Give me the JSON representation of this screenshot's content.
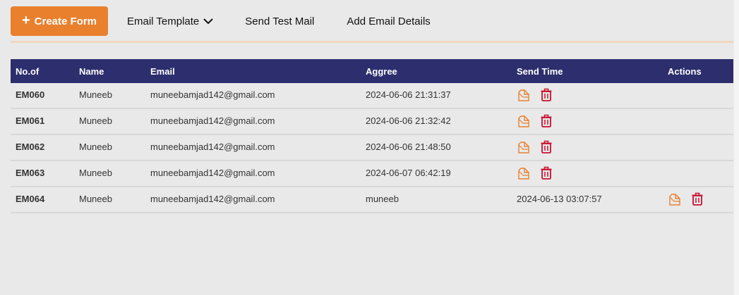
{
  "toolbar": {
    "create_label": "Create Form",
    "email_template_label": "Email Template",
    "send_test_label": "Send Test Mail",
    "add_details_label": "Add Email Details"
  },
  "table": {
    "headers": [
      "No.of",
      "Name",
      "Email",
      "Aggree",
      "Send Time",
      "Actions"
    ],
    "rows": [
      {
        "no": "EM060",
        "name": "Muneeb",
        "email": "muneebamjad142@gmail.com",
        "aggree": "2024-06-06 21:31:37",
        "send_time": ""
      },
      {
        "no": "EM061",
        "name": "Muneeb",
        "email": "muneebamjad142@gmail.com",
        "aggree": "2024-06-06 21:32:42",
        "send_time": ""
      },
      {
        "no": "EM062",
        "name": "Muneeb",
        "email": "muneebamjad142@gmail.com",
        "aggree": "2024-06-06 21:48:50",
        "send_time": ""
      },
      {
        "no": "EM063",
        "name": "Muneeb",
        "email": "muneebamjad142@gmail.com",
        "aggree": "2024-06-07 06:42:19",
        "send_time": ""
      },
      {
        "no": "EM064",
        "name": "Muneeb",
        "email": "muneebamjad142@gmail.com",
        "aggree": "muneeb",
        "send_time": "2024-06-13 03:07:57"
      }
    ]
  },
  "icons": {
    "edit": "edit-document-icon",
    "delete": "trash-icon"
  },
  "colors": {
    "accent": "#e9802e",
    "header_bg": "#2d2e6d",
    "delete": "#c8102e"
  }
}
